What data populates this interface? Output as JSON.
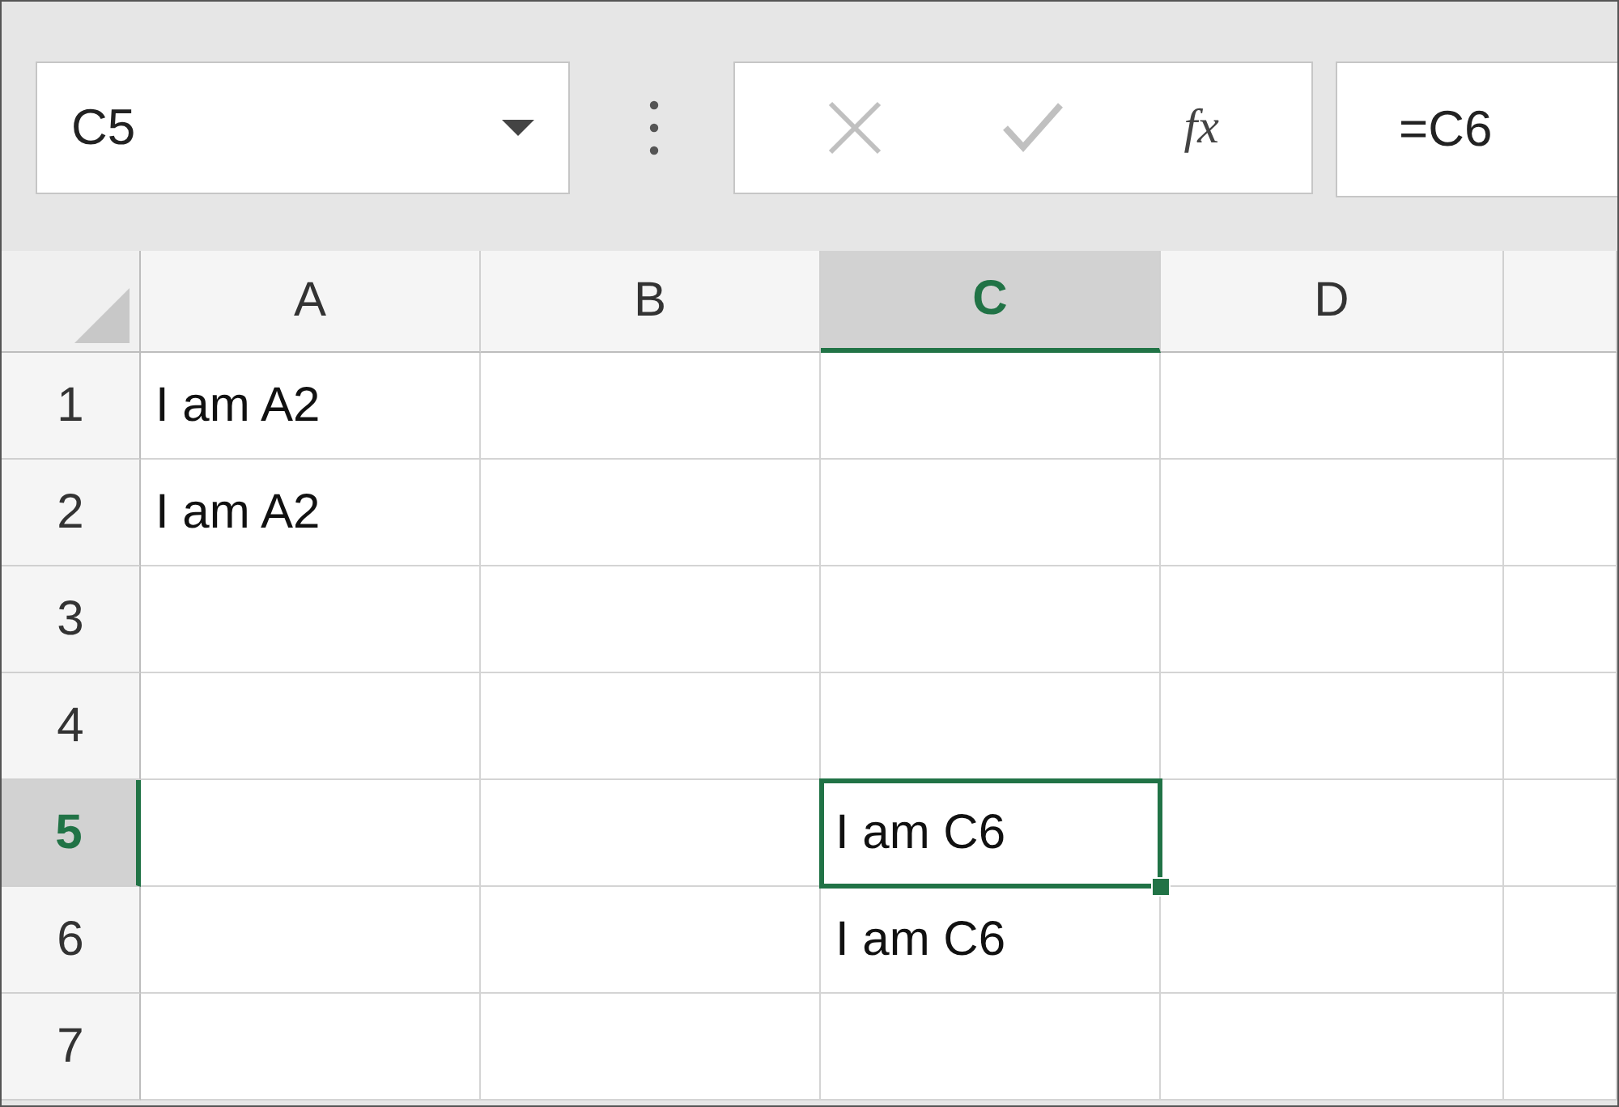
{
  "name_box": {
    "value": "C5"
  },
  "formula_bar": {
    "function_label": "fx",
    "value": "=C6"
  },
  "columns": [
    {
      "label": "A",
      "selected": false
    },
    {
      "label": "B",
      "selected": false
    },
    {
      "label": "C",
      "selected": true
    },
    {
      "label": "D",
      "selected": false
    }
  ],
  "rows": [
    {
      "label": "1",
      "selected": false,
      "cells": [
        {
          "text": "I am A2",
          "selected": false
        },
        {
          "selected": false
        },
        {
          "selected": false
        },
        {
          "selected": false
        }
      ]
    },
    {
      "label": "2",
      "selected": false,
      "cells": [
        {
          "text": "I am A2",
          "selected": false
        },
        {
          "selected": false
        },
        {
          "selected": false
        },
        {
          "selected": false
        }
      ]
    },
    {
      "label": "3",
      "selected": false,
      "cells": [
        {
          "selected": false
        },
        {
          "selected": false
        },
        {
          "selected": false
        },
        {
          "selected": false
        }
      ]
    },
    {
      "label": "4",
      "selected": false,
      "cells": [
        {
          "selected": false
        },
        {
          "selected": false
        },
        {
          "selected": false
        },
        {
          "selected": false
        }
      ]
    },
    {
      "label": "5",
      "selected": true,
      "cells": [
        {
          "selected": false
        },
        {
          "selected": false
        },
        {
          "text": "I am C6",
          "selected": true
        },
        {
          "selected": false
        }
      ]
    },
    {
      "label": "6",
      "selected": false,
      "cells": [
        {
          "selected": false
        },
        {
          "selected": false
        },
        {
          "text": "I am C6",
          "selected": false
        },
        {
          "selected": false
        }
      ]
    },
    {
      "label": "7",
      "selected": false,
      "cells": [
        {
          "selected": false
        },
        {
          "selected": false
        },
        {
          "selected": false
        },
        {
          "selected": false
        }
      ]
    }
  ]
}
